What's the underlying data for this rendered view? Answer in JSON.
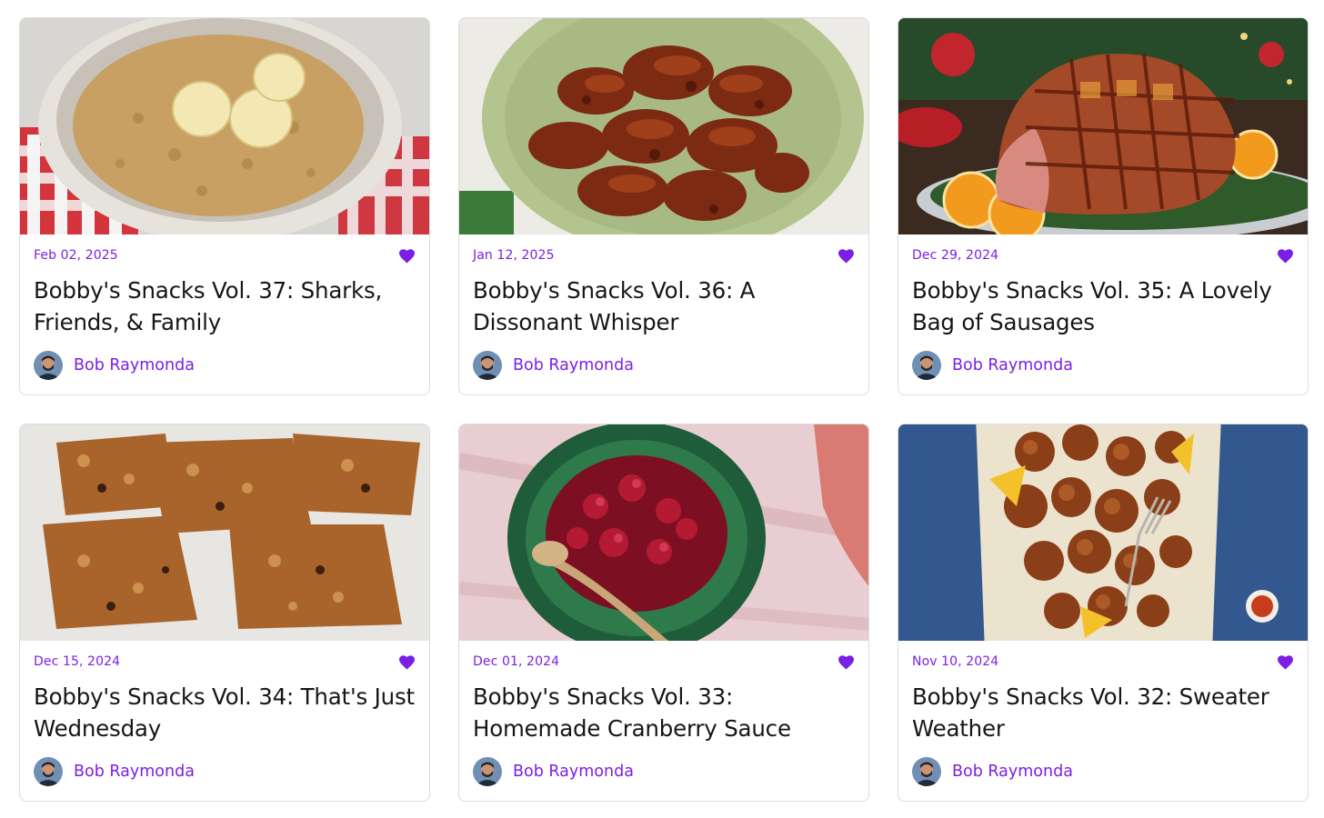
{
  "colors": {
    "accent": "#7b1fe6",
    "title": "#161616",
    "border": "#dcdcdc"
  },
  "icons": {
    "like": "heart-icon"
  },
  "posts": [
    {
      "date": "Feb 02, 2025",
      "title": "Bobby's Snacks Vol. 37: Sharks, Friends, & Family",
      "author": "Bob Raymonda",
      "image": "bowl of oatmeal topped with banana slices"
    },
    {
      "date": "Jan 12, 2025",
      "title": "Bobby's Snacks Vol. 36: A Dissonant Whisper",
      "author": "Bob Raymonda",
      "image": "platter of glazed chicken wings"
    },
    {
      "date": "Dec 29, 2024",
      "title": "Bobby's Snacks Vol. 35: A Lovely Bag of Sausages",
      "author": "Bob Raymonda",
      "image": "glazed holiday ham with orange slices"
    },
    {
      "date": "Dec 15, 2024",
      "title": "Bobby's Snacks Vol. 34: That's Just Wednesday",
      "author": "Bob Raymonda",
      "image": "seven-layer cookie bars"
    },
    {
      "date": "Dec 01, 2024",
      "title": "Bobby's Snacks Vol. 33: Homemade Cranberry Sauce",
      "author": "Bob Raymonda",
      "image": "green bowl of cranberry sauce"
    },
    {
      "date": "Nov 10, 2024",
      "title": "Bobby's Snacks Vol. 32: Sweater Weather",
      "author": "Bob Raymonda",
      "image": "platter of fried chicken with lemon wedges"
    }
  ]
}
